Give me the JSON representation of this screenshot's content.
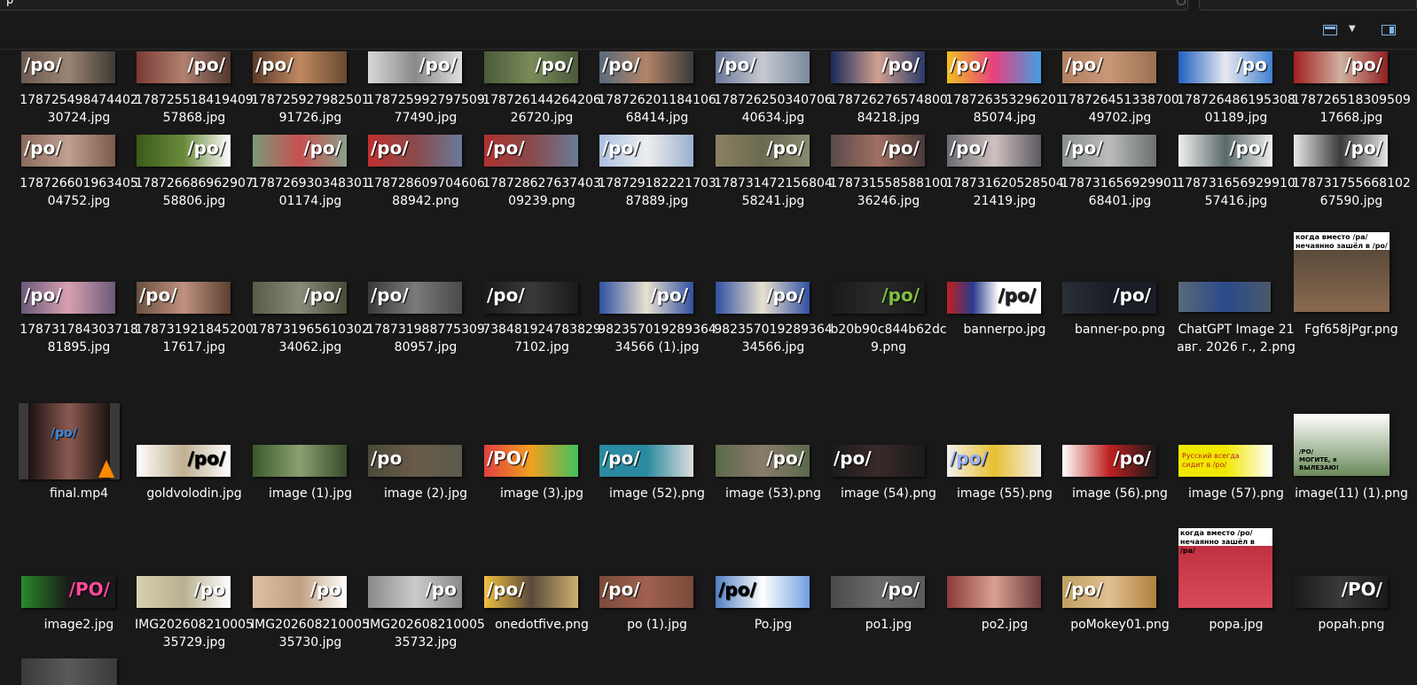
{
  "address_bar": {
    "text": "p"
  },
  "toolbar": {
    "view_icon": "view-layout-icon",
    "caret_icon": "chevron-down-icon",
    "pane_icon": "details-pane-icon"
  },
  "files": [
    {
      "name": "17872549847440230724.jpg",
      "label": "/po/"
    },
    {
      "name": "17872551841940957868.jpg",
      "label": "/po/"
    },
    {
      "name": "17872592798250191726.jpg",
      "label": "/po/"
    },
    {
      "name": "17872599279750977490.jpg",
      "label": "/po/"
    },
    {
      "name": "17872614426420626720.jpg",
      "label": "/po/"
    },
    {
      "name": "17872620118410668414.jpg",
      "label": "/po/"
    },
    {
      "name": "17872625034070640634.jpg",
      "label": "/po/"
    },
    {
      "name": "17872627657480084218.jpg",
      "label": "/po/"
    },
    {
      "name": "17872635329620185074.jpg",
      "label": "/po/"
    },
    {
      "name": "17872645133870049702.jpg",
      "label": "/po/"
    },
    {
      "name": "17872648619530801189.jpg",
      "label": "/po"
    },
    {
      "name": "17872651830950917668.jpg",
      "label": "/po/"
    },
    {
      "name": "17872660196340504752.jpg",
      "label": "/po/"
    },
    {
      "name": "17872668696290758806.jpg",
      "label": "/po/"
    },
    {
      "name": "17872693034830101174.jpg",
      "label": "/po/"
    },
    {
      "name": "17872860970460688942.png",
      "label": "/po/"
    },
    {
      "name": "17872862763740309239.png",
      "label": "/po/"
    },
    {
      "name": "17872918222170387889.jpg",
      "label": "/po/"
    },
    {
      "name": "17873147215680458241.jpg",
      "label": "/po/"
    },
    {
      "name": "17873155858810036246.jpg",
      "label": "/po/"
    },
    {
      "name": "17873162052850421419.jpg",
      "label": "/po/"
    },
    {
      "name": "17873165692990168401.jpg",
      "label": "/po/"
    },
    {
      "name": "17873165692991057416.jpg",
      "label": "/po/"
    },
    {
      "name": "17873175566810267590.jpg",
      "label": "/po/"
    },
    {
      "name": "17873178430371881895.jpg",
      "label": "/po/"
    },
    {
      "name": "17873192184520017617.jpg",
      "label": "/po/"
    },
    {
      "name": "17873196561030234062.jpg",
      "label": "/po/"
    },
    {
      "name": "17873198877530980957.jpg",
      "label": "/po/"
    },
    {
      "name": "7384819247838297102.jpg",
      "label": "/po/"
    },
    {
      "name": "98235701928936434566 (1).jpg",
      "label": "/po/"
    },
    {
      "name": "98235701928936434566.jpg",
      "label": "/po/"
    },
    {
      "name": "b20b90c844b62dc9.png",
      "label": "/po/"
    },
    {
      "name": "bannerpo.jpg",
      "label": "/po/"
    },
    {
      "name": "banner-po.png",
      "label": "/po/"
    },
    {
      "name": "ChatGPT Image 21 авг. 2026 г., 2.png",
      "label": ""
    },
    {
      "name": "Fgf658jPgr.png",
      "label": "когда вместо /pa/ нечаянно зашёл в /po/"
    },
    {
      "name": "final.mp4",
      "label": "/po/"
    },
    {
      "name": "goldvolodin.jpg",
      "label": "/po/"
    },
    {
      "name": "image (1).jpg",
      "label": "/po/"
    },
    {
      "name": "image (2).jpg",
      "label": "/po"
    },
    {
      "name": "image (3).jpg",
      "label": "/PO/"
    },
    {
      "name": "image (52).png",
      "label": "/po/"
    },
    {
      "name": "image (53).png",
      "label": "/po/"
    },
    {
      "name": "image (54).png",
      "label": "/po/"
    },
    {
      "name": "image (55).png",
      "label": "/po/"
    },
    {
      "name": "image (56).png",
      "label": "/po/"
    },
    {
      "name": "image (57).png",
      "label": "Русский всегда сидит в /po/"
    },
    {
      "name": "image(11) (1).png",
      "label": "/РО/МОГИТЕ, я ВЫЛЕЗАЮ!"
    },
    {
      "name": "image2.jpg",
      "label": "/PO/"
    },
    {
      "name": "IMG20260821000535729.jpg",
      "label": "/po"
    },
    {
      "name": "IMG20260821000535730.jpg",
      "label": "/po"
    },
    {
      "name": "IMG20260821000535732.jpg",
      "label": "/po"
    },
    {
      "name": "onedotfive.png",
      "label": "/po/"
    },
    {
      "name": "po (1).jpg",
      "label": "/po/"
    },
    {
      "name": "Po.jpg",
      "label": "/po/"
    },
    {
      "name": "po1.jpg",
      "label": "/po/"
    },
    {
      "name": "po2.jpg",
      "label": "/po/"
    },
    {
      "name": "poMokey01.png",
      "label": "/po/"
    },
    {
      "name": "popa.jpg",
      "label": "когда вместо /po/ нечаянно зашёл в /pa/"
    },
    {
      "name": "popah.png",
      "label": "/PO/"
    },
    {
      "name": "",
      "label": ""
    }
  ],
  "theme": {
    "background": "#191919",
    "text": "#ffffff",
    "accent": "#7fb2e5"
  }
}
